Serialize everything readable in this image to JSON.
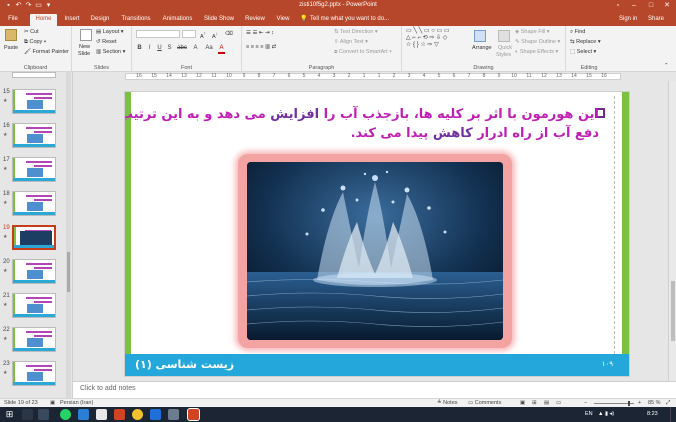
{
  "window": {
    "title": "zisti10f5g2.pptx - PowerPoint",
    "quick_access": [
      "save-icon",
      "undo-icon",
      "redo-icon",
      "start-from-beginning-icon",
      "customize-icon"
    ],
    "controls": [
      "ribbon-display-icon",
      "minimize-icon",
      "maximize-icon",
      "close-icon"
    ]
  },
  "tabs": {
    "file": "File",
    "home": "Home",
    "insert": "Insert",
    "design": "Design",
    "transitions": "Transitions",
    "animations": "Animations",
    "slideshow": "Slide Show",
    "review": "Review",
    "view": "View",
    "tellme": "Tell me what you want to do...",
    "signin": "Sign in",
    "share": "Share"
  },
  "ribbon": {
    "clipboard": {
      "label": "Clipboard",
      "paste": "Paste",
      "cut": "Cut",
      "copy": "Copy",
      "format_painter": "Format Painter"
    },
    "slides": {
      "label": "Slides",
      "new_slide": "New",
      "new_slide2": "Slide",
      "layout": "Layout",
      "reset": "Reset",
      "section": "Section"
    },
    "font": {
      "label": "Font",
      "buttons": [
        "B",
        "I",
        "U",
        "S",
        "abc",
        "A",
        "Aa",
        "A"
      ]
    },
    "paragraph": {
      "label": "Paragraph",
      "text_direction": "Text Direction",
      "align_text": "Align Text",
      "smartart": "Convert to SmartArt"
    },
    "drawing": {
      "label": "Drawing",
      "arrange": "Arrange",
      "quick_styles": "Quick",
      "quick_styles2": "Styles",
      "shape_fill": "Shape Fill",
      "shape_outline": "Shape Outline",
      "shape_effects": "Shape Effects"
    },
    "editing": {
      "label": "Editing",
      "find": "Find",
      "replace": "Replace",
      "select": "Select"
    }
  },
  "ruler": {
    "numbers": [
      "16",
      "15",
      "14",
      "13",
      "12",
      "11",
      "10",
      "9",
      "8",
      "7",
      "6",
      "5",
      "4",
      "3",
      "2",
      "1",
      "1",
      "2",
      "3",
      "4",
      "5",
      "6",
      "7",
      "8",
      "9",
      "10",
      "11",
      "12",
      "13",
      "14",
      "15",
      "16"
    ]
  },
  "thumbnails": [
    {
      "num": "15",
      "star": "★"
    },
    {
      "num": "16",
      "star": "★"
    },
    {
      "num": "17",
      "star": "★"
    },
    {
      "num": "18",
      "star": "★"
    },
    {
      "num": "19",
      "star": "★"
    },
    {
      "num": "20",
      "star": "★"
    },
    {
      "num": "21",
      "star": "★"
    },
    {
      "num": "22",
      "star": "★"
    },
    {
      "num": "23",
      "star": "★"
    }
  ],
  "slide": {
    "line1_a": "این هورمون با اثر بر کلیه ها، بازجذب آب را ",
    "line1_b": "افزایش",
    "line1_c": " می دهد و به این ترتیب",
    "line2_a": "دفع آب از راه ادرار ",
    "line2_b": "کاهش",
    "line2_c": " پیدا می کند.",
    "footer_title": "زیست شناسی (۱)",
    "footer_page": "۱۰۹"
  },
  "notes": {
    "placeholder": "Click to add notes"
  },
  "status": {
    "slide_info": "Slide 19 of 23",
    "language": "Persian (Iran)",
    "notes": "Notes",
    "comments": "Comments",
    "zoom": "85 %"
  },
  "taskbar": {
    "language": "EN",
    "time": "8:23"
  },
  "colors": {
    "accent": "#b7472a",
    "slide_text": "#c01fb5",
    "slide_text_dark": "#7030a0",
    "footer_bar": "#24a8dc",
    "side_bar": "#7cc242"
  }
}
